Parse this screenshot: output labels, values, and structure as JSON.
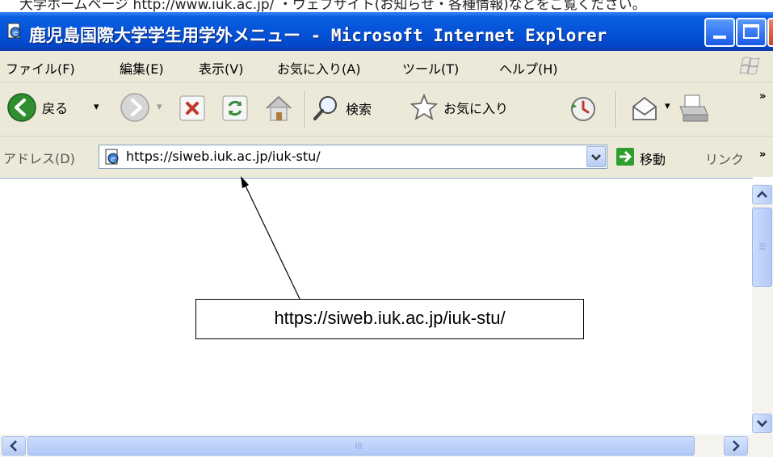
{
  "document_strip_text": "大学ホームページ http://www.iuk.ac.jp/ ・ウェブサイト(お知らせ・各種情報)などをご覧ください。",
  "window": {
    "title": "鹿児島国際大学学生用学外メニュー - Microsoft Internet Explorer"
  },
  "menubar": {
    "items": [
      "ファイル(F)",
      "編集(E)",
      "表示(V)",
      "お気に入り(A)",
      "ツール(T)",
      "ヘルプ(H)"
    ]
  },
  "toolbar": {
    "back_label": "戻る",
    "search_label": "検索",
    "favorites_label": "お気に入り"
  },
  "addressbar": {
    "label": "アドレス(D)",
    "url": "https://siweb.iuk.ac.jp/iuk-stu/",
    "go_label": "移動",
    "links_label": "リンク"
  },
  "callout": {
    "text": "https://siweb.iuk.ac.jp/iuk-stu/"
  },
  "colors": {
    "titlebar": "#0553d8",
    "chrome": "#ece9d8",
    "address_border": "#7f9db9"
  }
}
